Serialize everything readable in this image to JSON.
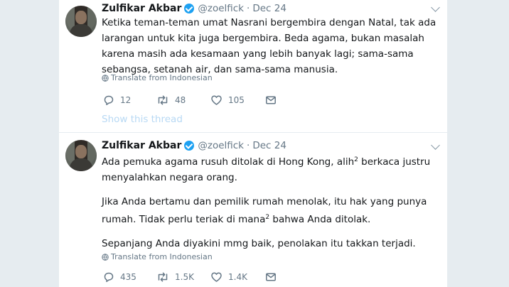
{
  "tweets": [
    {
      "name": "Zulfikar Akbar",
      "handle": "@zoelfick",
      "separator": "·",
      "date": "Dec 24",
      "text": "Ketika teman-teman umat Nasrani bergembira dengan Natal, tak ada larangan untuk kita juga bergembira. Beda agama, bukan masalah karena masih ada kesamaan yang lebih banyak lagi; sama-sama sebangsa, setanah air, dan sama-sama manusia.",
      "translate": "Translate from Indonesian",
      "replies": "12",
      "retweets": "48",
      "likes": "105",
      "show_thread": "Show this thread"
    },
    {
      "name": "Zulfikar Akbar",
      "handle": "@zoelfick",
      "separator": "·",
      "date": "Dec 24",
      "para1_a": "Ada pemuka agama rusuh ditolak di Hong Kong, alih",
      "para1_sup": "2",
      "para1_b": " berkaca justru menyalahkan negara orang.",
      "para2_a": "Jika Anda bertamu dan pemilik rumah menolak, itu hak yang punya rumah. Tidak perlu teriak di mana",
      "para2_sup": "2",
      "para2_b": " bahwa Anda ditolak.",
      "para3": "Sepanjang Anda diyakini mmg baik, penolakan itu takkan terjadi.",
      "translate": "Translate from Indonesian",
      "replies": "435",
      "retweets": "1.5K",
      "likes": "1.4K"
    }
  ],
  "colors": {
    "verified": "#1da1f2",
    "muted": "#657786",
    "show_thread": "#b8d9f4",
    "background": "#e6ecf0"
  },
  "icons": [
    "verified-badge-icon",
    "chevron-down-icon",
    "globe-icon",
    "reply-icon",
    "retweet-icon",
    "like-icon",
    "direct-message-icon"
  ]
}
